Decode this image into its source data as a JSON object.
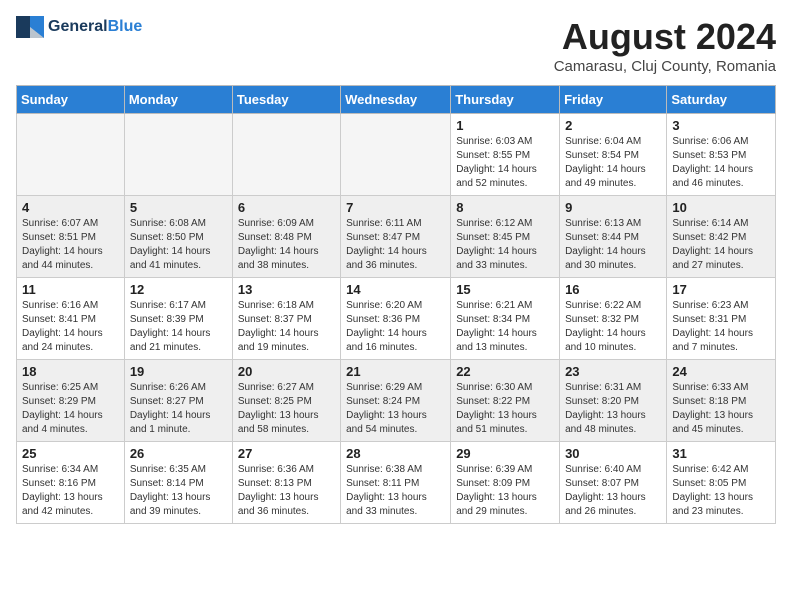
{
  "header": {
    "logo_general": "General",
    "logo_blue": "Blue",
    "month_title": "August 2024",
    "location": "Camarasu, Cluj County, Romania"
  },
  "days_of_week": [
    "Sunday",
    "Monday",
    "Tuesday",
    "Wednesday",
    "Thursday",
    "Friday",
    "Saturday"
  ],
  "weeks": [
    [
      {
        "date": "",
        "info": ""
      },
      {
        "date": "",
        "info": ""
      },
      {
        "date": "",
        "info": ""
      },
      {
        "date": "",
        "info": ""
      },
      {
        "date": "1",
        "info": "Sunrise: 6:03 AM\nSunset: 8:55 PM\nDaylight: 14 hours and 52 minutes."
      },
      {
        "date": "2",
        "info": "Sunrise: 6:04 AM\nSunset: 8:54 PM\nDaylight: 14 hours and 49 minutes."
      },
      {
        "date": "3",
        "info": "Sunrise: 6:06 AM\nSunset: 8:53 PM\nDaylight: 14 hours and 46 minutes."
      }
    ],
    [
      {
        "date": "4",
        "info": "Sunrise: 6:07 AM\nSunset: 8:51 PM\nDaylight: 14 hours and 44 minutes."
      },
      {
        "date": "5",
        "info": "Sunrise: 6:08 AM\nSunset: 8:50 PM\nDaylight: 14 hours and 41 minutes."
      },
      {
        "date": "6",
        "info": "Sunrise: 6:09 AM\nSunset: 8:48 PM\nDaylight: 14 hours and 38 minutes."
      },
      {
        "date": "7",
        "info": "Sunrise: 6:11 AM\nSunset: 8:47 PM\nDaylight: 14 hours and 36 minutes."
      },
      {
        "date": "8",
        "info": "Sunrise: 6:12 AM\nSunset: 8:45 PM\nDaylight: 14 hours and 33 minutes."
      },
      {
        "date": "9",
        "info": "Sunrise: 6:13 AM\nSunset: 8:44 PM\nDaylight: 14 hours and 30 minutes."
      },
      {
        "date": "10",
        "info": "Sunrise: 6:14 AM\nSunset: 8:42 PM\nDaylight: 14 hours and 27 minutes."
      }
    ],
    [
      {
        "date": "11",
        "info": "Sunrise: 6:16 AM\nSunset: 8:41 PM\nDaylight: 14 hours and 24 minutes."
      },
      {
        "date": "12",
        "info": "Sunrise: 6:17 AM\nSunset: 8:39 PM\nDaylight: 14 hours and 21 minutes."
      },
      {
        "date": "13",
        "info": "Sunrise: 6:18 AM\nSunset: 8:37 PM\nDaylight: 14 hours and 19 minutes."
      },
      {
        "date": "14",
        "info": "Sunrise: 6:20 AM\nSunset: 8:36 PM\nDaylight: 14 hours and 16 minutes."
      },
      {
        "date": "15",
        "info": "Sunrise: 6:21 AM\nSunset: 8:34 PM\nDaylight: 14 hours and 13 minutes."
      },
      {
        "date": "16",
        "info": "Sunrise: 6:22 AM\nSunset: 8:32 PM\nDaylight: 14 hours and 10 minutes."
      },
      {
        "date": "17",
        "info": "Sunrise: 6:23 AM\nSunset: 8:31 PM\nDaylight: 14 hours and 7 minutes."
      }
    ],
    [
      {
        "date": "18",
        "info": "Sunrise: 6:25 AM\nSunset: 8:29 PM\nDaylight: 14 hours and 4 minutes."
      },
      {
        "date": "19",
        "info": "Sunrise: 6:26 AM\nSunset: 8:27 PM\nDaylight: 14 hours and 1 minute."
      },
      {
        "date": "20",
        "info": "Sunrise: 6:27 AM\nSunset: 8:25 PM\nDaylight: 13 hours and 58 minutes."
      },
      {
        "date": "21",
        "info": "Sunrise: 6:29 AM\nSunset: 8:24 PM\nDaylight: 13 hours and 54 minutes."
      },
      {
        "date": "22",
        "info": "Sunrise: 6:30 AM\nSunset: 8:22 PM\nDaylight: 13 hours and 51 minutes."
      },
      {
        "date": "23",
        "info": "Sunrise: 6:31 AM\nSunset: 8:20 PM\nDaylight: 13 hours and 48 minutes."
      },
      {
        "date": "24",
        "info": "Sunrise: 6:33 AM\nSunset: 8:18 PM\nDaylight: 13 hours and 45 minutes."
      }
    ],
    [
      {
        "date": "25",
        "info": "Sunrise: 6:34 AM\nSunset: 8:16 PM\nDaylight: 13 hours and 42 minutes."
      },
      {
        "date": "26",
        "info": "Sunrise: 6:35 AM\nSunset: 8:14 PM\nDaylight: 13 hours and 39 minutes."
      },
      {
        "date": "27",
        "info": "Sunrise: 6:36 AM\nSunset: 8:13 PM\nDaylight: 13 hours and 36 minutes."
      },
      {
        "date": "28",
        "info": "Sunrise: 6:38 AM\nSunset: 8:11 PM\nDaylight: 13 hours and 33 minutes."
      },
      {
        "date": "29",
        "info": "Sunrise: 6:39 AM\nSunset: 8:09 PM\nDaylight: 13 hours and 29 minutes."
      },
      {
        "date": "30",
        "info": "Sunrise: 6:40 AM\nSunset: 8:07 PM\nDaylight: 13 hours and 26 minutes."
      },
      {
        "date": "31",
        "info": "Sunrise: 6:42 AM\nSunset: 8:05 PM\nDaylight: 13 hours and 23 minutes."
      }
    ]
  ]
}
